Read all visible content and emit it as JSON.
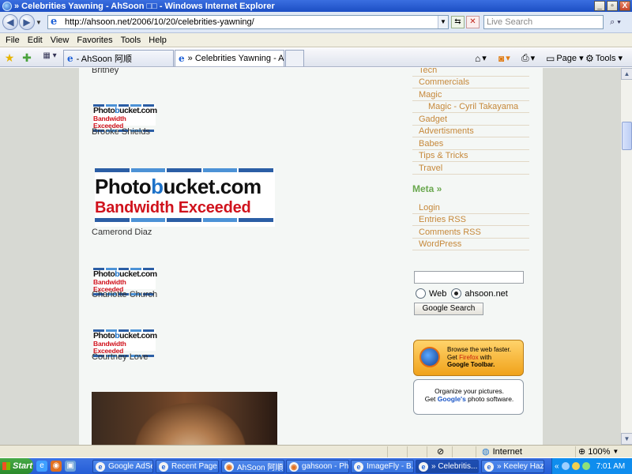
{
  "window": {
    "title": "» Celebrities Yawning - AhSoon □□ - Windows Internet Explorer",
    "btn_min": "_",
    "btn_max": "▫",
    "btn_close": "X"
  },
  "address": {
    "url": "http://ahsoon.net/2006/10/20/celebrities-yawning/",
    "search_placeholder": "Live Search"
  },
  "menu": [
    "File",
    "Edit",
    "View",
    "Favorites",
    "Tools",
    "Help"
  ],
  "tabs": [
    {
      "label": "- AhSoon 阿顺"
    },
    {
      "label": "» Celebrities Yawning - A..."
    }
  ],
  "toolbar": {
    "page_label": "Page",
    "tools_label": "Tools"
  },
  "content": {
    "broken_image": {
      "logo_prefix": "Photo",
      "logo_b": "b",
      "logo_suffix": "ucket.com",
      "exceeded": "Bandwidth Exceeded"
    },
    "captions": [
      "Britney",
      "Brooke Shields",
      "Camerond Diaz",
      "Charlotte Church",
      "Courtney Love"
    ]
  },
  "sidebar": {
    "links": [
      {
        "label": "Tech",
        "sub": false
      },
      {
        "label": "Commercials",
        "sub": false
      },
      {
        "label": "Magic",
        "sub": false
      },
      {
        "label": "Magic - Cyril Takayama",
        "sub": true
      },
      {
        "label": "Gadget",
        "sub": false
      },
      {
        "label": "Advertisments",
        "sub": false
      },
      {
        "label": "Babes",
        "sub": false
      },
      {
        "label": "Tips & Tricks",
        "sub": false
      },
      {
        "label": "Travel",
        "sub": false
      }
    ],
    "meta_heading": "Meta »",
    "meta_links": [
      "Login",
      "Entries RSS",
      "Comments RSS",
      "WordPress"
    ],
    "search": {
      "radio_web": "Web",
      "radio_site": "ahsoon.net",
      "button": "Google Search"
    },
    "ad_firefox": {
      "line1": "Browse the web faster.",
      "line2a": "Get ",
      "line2b": "Firefox",
      "line2c": " with",
      "line3": "Google Toolbar."
    },
    "ad_picasa": {
      "line1": "Organize your pictures.",
      "line2a": "Get ",
      "line2b": "Google's",
      "line2c": " photo software."
    }
  },
  "status": {
    "zone": "Internet",
    "zoom": "100%"
  },
  "taskbar": {
    "start": "Start",
    "buttons": [
      {
        "label": "Google AdSe..."
      },
      {
        "label": "Recent Page..."
      },
      {
        "label": "AhSoon 阿順..."
      },
      {
        "label": "gahsoon - Ph..."
      },
      {
        "label": "ImageFly - B..."
      },
      {
        "label": "» Celebritis..."
      },
      {
        "label": "» Keeley Haz..."
      }
    ],
    "clock": "7:01 AM"
  },
  "colors": {
    "link": "#c6883a",
    "meta": "#6aa84f",
    "titlebar": "#1c4fc4"
  }
}
